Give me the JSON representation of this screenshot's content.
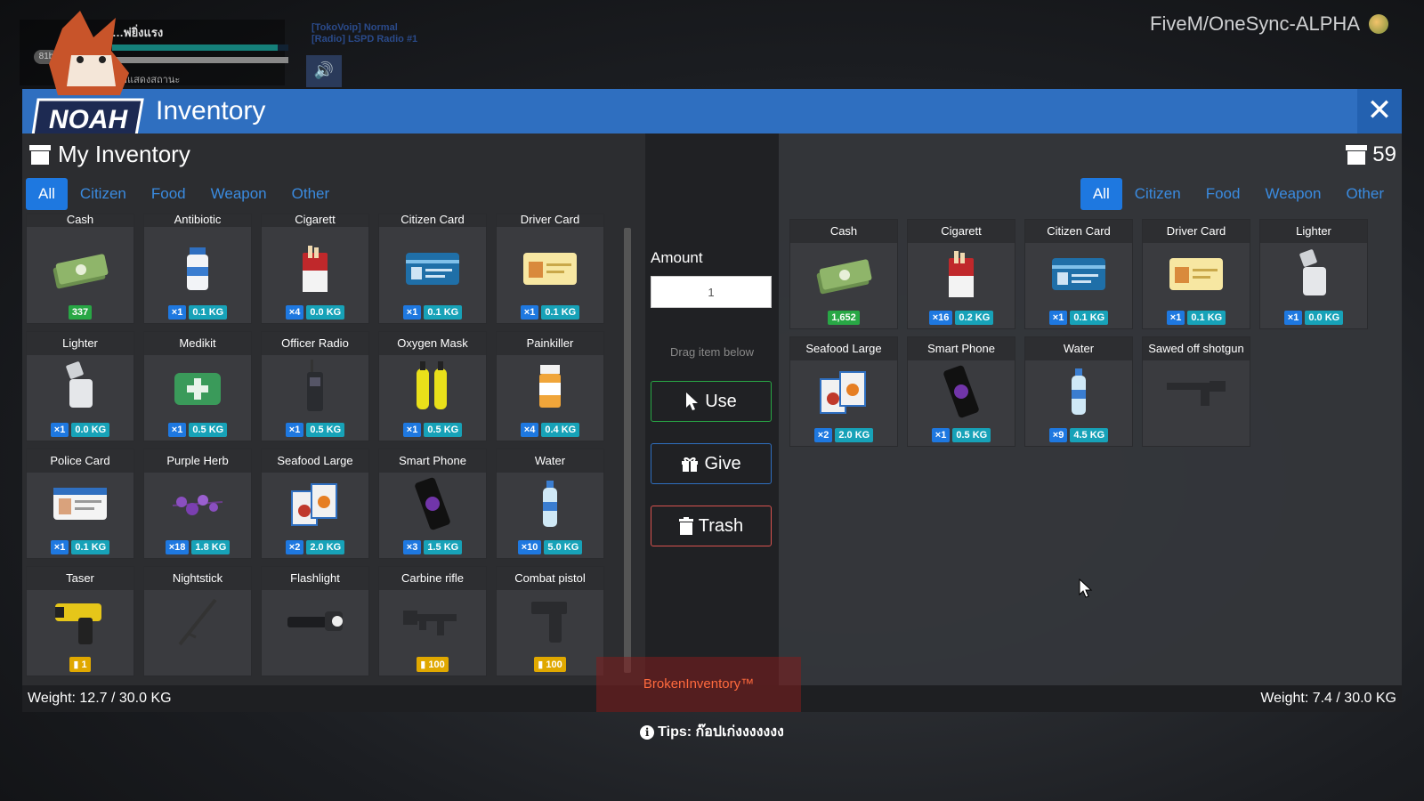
{
  "hud": {
    "player_name": "…พ่ยิ่งแรง",
    "badge": "81b",
    "hint": "กด (J) ค้างไว้เพื่อแสดงสถานะ",
    "voip_line1": "[TokoVoip] Normal",
    "voip_line2": "[Radio] LSPD Radio #1"
  },
  "server_title": "FiveM/OneSync-ALPHA",
  "window": {
    "title": "Inventory",
    "logo_text": "NOAH",
    "close_label": "✕"
  },
  "left": {
    "title": "My Inventory",
    "tabs": [
      "All",
      "Citizen",
      "Food",
      "Weapon",
      "Other"
    ],
    "active_tab": "All",
    "weight": "Weight: 12.7 / 30.0 KG",
    "items": [
      {
        "name": "Cash",
        "icon": "cash",
        "tags": [
          {
            "t": "money",
            "v": "337"
          }
        ]
      },
      {
        "name": "Antibiotic",
        "icon": "bottle",
        "tags": [
          {
            "t": "qty",
            "v": "×1"
          },
          {
            "t": "kg",
            "v": "0.1 KG"
          }
        ]
      },
      {
        "name": "Cigarett",
        "icon": "cigarette",
        "tags": [
          {
            "t": "qty",
            "v": "×4"
          },
          {
            "t": "kg",
            "v": "0.0 KG"
          }
        ]
      },
      {
        "name": "Citizen Card",
        "icon": "card-blue",
        "tags": [
          {
            "t": "qty",
            "v": "×1"
          },
          {
            "t": "kg",
            "v": "0.1 KG"
          }
        ]
      },
      {
        "name": "Driver Card",
        "icon": "card-yellow",
        "tags": [
          {
            "t": "qty",
            "v": "×1"
          },
          {
            "t": "kg",
            "v": "0.1 KG"
          }
        ]
      },
      {
        "name": "Lighter",
        "icon": "lighter",
        "tags": [
          {
            "t": "qty",
            "v": "×1"
          },
          {
            "t": "kg",
            "v": "0.0 KG"
          }
        ]
      },
      {
        "name": "Medikit",
        "icon": "medikit",
        "tags": [
          {
            "t": "qty",
            "v": "×1"
          },
          {
            "t": "kg",
            "v": "0.5 KG"
          }
        ]
      },
      {
        "name": "Officer Radio",
        "icon": "radio",
        "tags": [
          {
            "t": "qty",
            "v": "×1"
          },
          {
            "t": "kg",
            "v": "0.5 KG"
          }
        ]
      },
      {
        "name": "Oxygen Mask",
        "icon": "oxygen",
        "tags": [
          {
            "t": "qty",
            "v": "×1"
          },
          {
            "t": "kg",
            "v": "0.5 KG"
          }
        ]
      },
      {
        "name": "Painkiller",
        "icon": "pills",
        "tags": [
          {
            "t": "qty",
            "v": "×4"
          },
          {
            "t": "kg",
            "v": "0.4 KG"
          }
        ]
      },
      {
        "name": "Police Card",
        "icon": "card-white",
        "tags": [
          {
            "t": "qty",
            "v": "×1"
          },
          {
            "t": "kg",
            "v": "0.1 KG"
          }
        ]
      },
      {
        "name": "Purple Herb",
        "icon": "herb",
        "tags": [
          {
            "t": "qty",
            "v": "×18"
          },
          {
            "t": "kg",
            "v": "1.8 KG"
          }
        ]
      },
      {
        "name": "Seafood Large",
        "icon": "seafood",
        "tags": [
          {
            "t": "qty",
            "v": "×2"
          },
          {
            "t": "kg",
            "v": "2.0 KG"
          }
        ]
      },
      {
        "name": "Smart Phone",
        "icon": "phone",
        "tags": [
          {
            "t": "qty",
            "v": "×3"
          },
          {
            "t": "kg",
            "v": "1.5 KG"
          }
        ]
      },
      {
        "name": "Water",
        "icon": "water",
        "tags": [
          {
            "t": "qty",
            "v": "×10"
          },
          {
            "t": "kg",
            "v": "5.0 KG"
          }
        ]
      },
      {
        "name": "Taser",
        "icon": "taser",
        "tags": [
          {
            "t": "ammo",
            "v": "1"
          }
        ]
      },
      {
        "name": "Nightstick",
        "icon": "nightstick",
        "tags": []
      },
      {
        "name": "Flashlight",
        "icon": "flashlight",
        "tags": []
      },
      {
        "name": "Carbine rifle",
        "icon": "rifle",
        "tags": [
          {
            "t": "ammo",
            "v": "100"
          }
        ]
      },
      {
        "name": "Combat pistol",
        "icon": "pistol",
        "tags": [
          {
            "t": "ammo",
            "v": "100"
          }
        ]
      }
    ]
  },
  "middle": {
    "amount_label": "Amount",
    "amount_value": "1",
    "drag_hint": "Drag item below",
    "use_label": "Use",
    "give_label": "Give",
    "trash_label": "Trash"
  },
  "right": {
    "count": "59",
    "tabs": [
      "All",
      "Citizen",
      "Food",
      "Weapon",
      "Other"
    ],
    "active_tab": "All",
    "weight": "Weight: 7.4 / 30.0 KG",
    "items": [
      {
        "name": "Cash",
        "icon": "cash",
        "tags": [
          {
            "t": "money",
            "v": "1,652"
          }
        ]
      },
      {
        "name": "Cigarett",
        "icon": "cigarette",
        "tags": [
          {
            "t": "qty",
            "v": "×16"
          },
          {
            "t": "kg",
            "v": "0.2 KG"
          }
        ]
      },
      {
        "name": "Citizen Card",
        "icon": "card-blue",
        "tags": [
          {
            "t": "qty",
            "v": "×1"
          },
          {
            "t": "kg",
            "v": "0.1 KG"
          }
        ]
      },
      {
        "name": "Driver Card",
        "icon": "card-yellow",
        "tags": [
          {
            "t": "qty",
            "v": "×1"
          },
          {
            "t": "kg",
            "v": "0.1 KG"
          }
        ]
      },
      {
        "name": "Lighter",
        "icon": "lighter",
        "tags": [
          {
            "t": "qty",
            "v": "×1"
          },
          {
            "t": "kg",
            "v": "0.0 KG"
          }
        ]
      },
      {
        "name": "Seafood Large",
        "icon": "seafood",
        "tags": [
          {
            "t": "qty",
            "v": "×2"
          },
          {
            "t": "kg",
            "v": "2.0 KG"
          }
        ]
      },
      {
        "name": "Smart Phone",
        "icon": "phone",
        "tags": [
          {
            "t": "qty",
            "v": "×1"
          },
          {
            "t": "kg",
            "v": "0.5 KG"
          }
        ]
      },
      {
        "name": "Water",
        "icon": "water",
        "tags": [
          {
            "t": "qty",
            "v": "×9"
          },
          {
            "t": "kg",
            "v": "4.5 KG"
          }
        ]
      },
      {
        "name": "Sawed off shotgun",
        "icon": "shotgun",
        "tags": []
      }
    ]
  },
  "brand": "BrokenInventory™",
  "tips": "Tips: ก๊อปเก่งงงงงงง"
}
